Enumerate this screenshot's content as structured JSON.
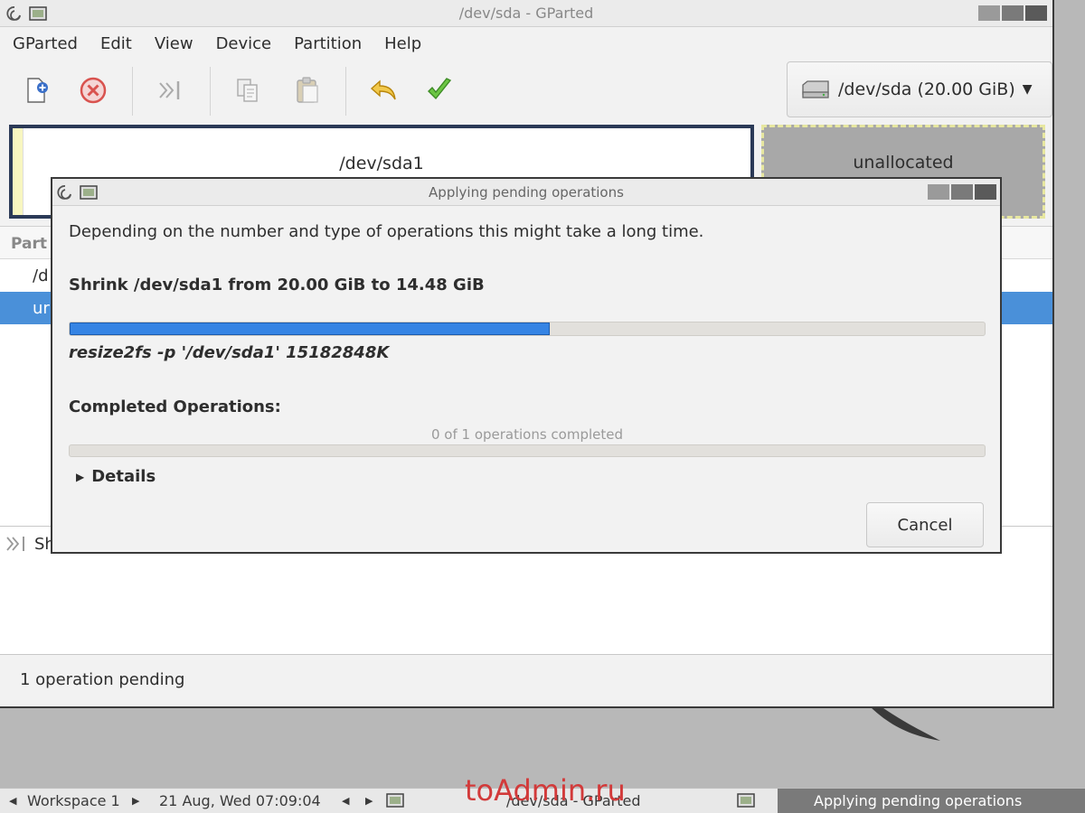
{
  "main_window": {
    "title": "/dev/sda - GParted",
    "menu": [
      "GParted",
      "Edit",
      "View",
      "Device",
      "Partition",
      "Help"
    ],
    "device_selector": "/dev/sda (20.00 GiB)",
    "disk_map": {
      "partition_label": "/dev/sda1",
      "unallocated_label": "unallocated"
    },
    "list": {
      "header": "Part",
      "rows": [
        "/d",
        "ur"
      ]
    },
    "pending_op_label": "Sh",
    "status": "1 operation pending"
  },
  "dialog": {
    "title": "Applying pending operations",
    "description": "Depending on the number and type of operations this might take a long time.",
    "operation": "Shrink /dev/sda1 from 20.00 GiB to 14.48 GiB",
    "progress_fraction": 0.525,
    "command": "resize2fs -p '/dev/sda1' 15182848K",
    "completed_label": "Completed Operations:",
    "completed_text": "0 of 1 operations completed",
    "completed_fraction": 0,
    "details_label": "Details",
    "cancel_label": "Cancel"
  },
  "taskbar": {
    "workspace": "Workspace 1",
    "datetime": "21 Aug, Wed 07:09:04",
    "task_gparted": "/dev/sda - GParted",
    "task_apply": "Applying pending operations"
  },
  "watermark": "toAdmin.ru",
  "colors": {
    "accent": "#3584e4",
    "selection": "#4a90d9",
    "partition_border": "#2b3a57",
    "unallocated": "#a8a8a8"
  },
  "icons": [
    "debian-swirl-icon",
    "app-window-icon",
    "new-icon",
    "delete-icon",
    "resize-move-icon",
    "copy-icon",
    "paste-icon",
    "undo-icon",
    "apply-icon",
    "harddisk-icon",
    "dropdown-arrow-icon",
    "expander-triangle-icon"
  ]
}
